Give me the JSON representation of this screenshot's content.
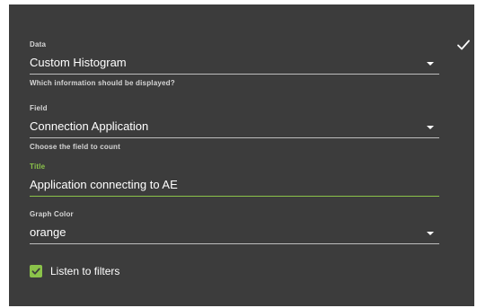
{
  "form": {
    "data_field": {
      "label": "Data",
      "value": "Custom Histogram",
      "helper": "Which information should be displayed?",
      "icon": "chevron-down-icon"
    },
    "field_field": {
      "label": "Field",
      "value": "Connection Application",
      "helper": "Choose the field to count",
      "icon": "chevron-down-icon"
    },
    "title_field": {
      "label": "Title",
      "value": "Application connecting to AE"
    },
    "color_field": {
      "label": "Graph Color",
      "value": "orange",
      "icon": "chevron-down-icon"
    },
    "listen_filters": {
      "label": "Listen to filters",
      "checked": true
    },
    "confirm_icon": "checkmark-icon"
  },
  "colors": {
    "panel_bg": "#3c3c3c",
    "accent": "#8bc34a",
    "text": "#ffffff",
    "muted": "#d6d6d6"
  }
}
